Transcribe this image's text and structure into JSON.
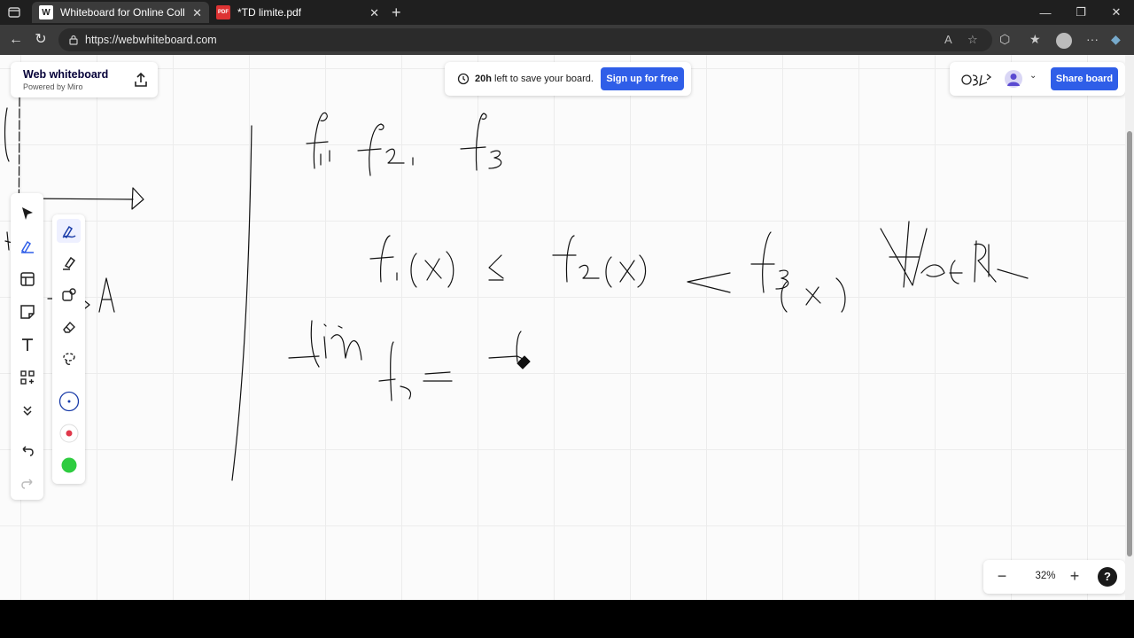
{
  "browser": {
    "tabs": [
      {
        "title": "Whiteboard for Online Collaboration",
        "favicon": "W",
        "active": true
      },
      {
        "title": "*TD limite.pdf",
        "favicon": "PDF",
        "active": false
      }
    ],
    "url": "https://webwhiteboard.com"
  },
  "brand": {
    "name": "Web whiteboard",
    "subtitle": "Powered by Miro"
  },
  "banner": {
    "time_left": "20h",
    "message": "left to save your board.",
    "signup_label": "Sign up for free"
  },
  "collab": {
    "share_label": "Share board"
  },
  "zoom": {
    "level": "32%",
    "help": "?"
  },
  "colors": {
    "accent": "#2f5ee8",
    "pen_blue": "#1a3ca8",
    "pen_red": "#e0384a",
    "pen_green": "#2ecc40",
    "ink": "#111111"
  },
  "toolbar_icons": [
    "select-icon",
    "pen-icon",
    "frame-icon",
    "sticky-note-icon",
    "text-icon",
    "apps-icon",
    "more-tools-icon",
    "undo-icon",
    "redo-icon"
  ],
  "pen_tools": [
    "pen-icon",
    "highlighter-icon",
    "shape-pen-icon",
    "eraser-icon",
    "lasso-icon",
    "color-navy",
    "color-red",
    "color-green"
  ]
}
